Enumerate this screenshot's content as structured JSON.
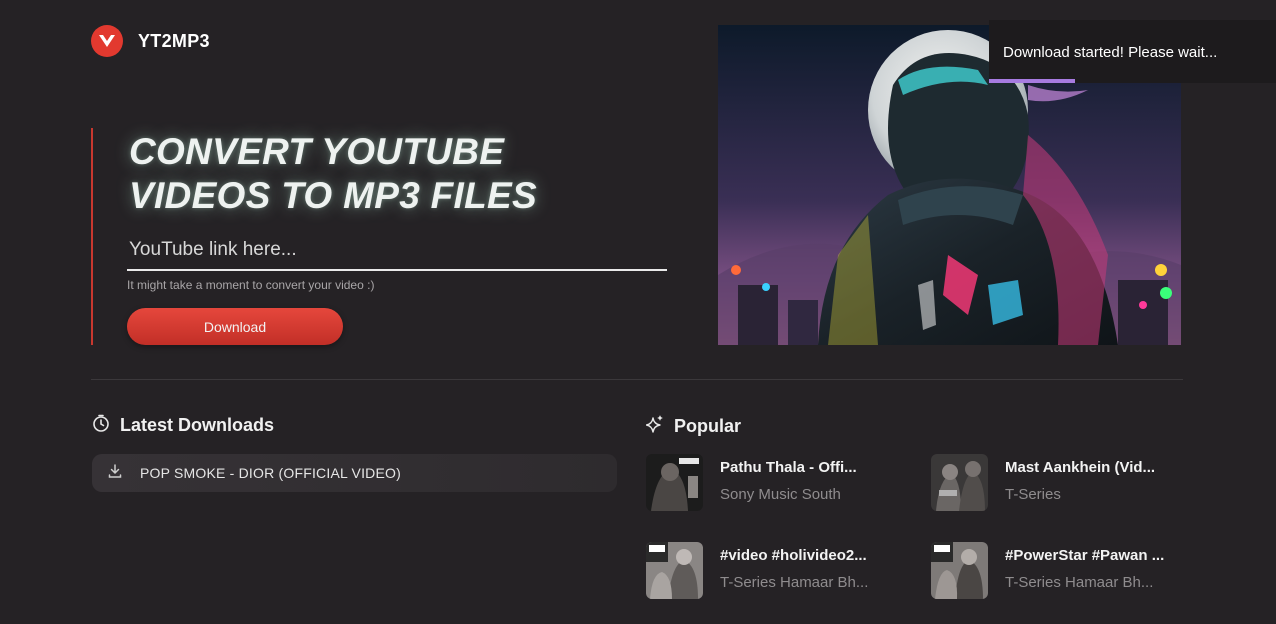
{
  "brand": {
    "name": "YT2MP3",
    "logo_color": "#e2392f",
    "icon": "chevron-v-logo-icon"
  },
  "hero": {
    "title_line1": "CONVERT YOUTUBE",
    "title_line2": "VIDEOS TO MP3 FILES",
    "input_placeholder": "YouTube link here...",
    "input_value": "",
    "hint": "It might take a moment to convert your video :)",
    "download_label": "Download",
    "accent_color": "#c8382f"
  },
  "latest": {
    "title": "Latest Downloads",
    "icon": "clock-icon",
    "items": [
      {
        "label": "POP SMOKE - DIOR (OFFICIAL VIDEO)",
        "icon": "download-icon"
      }
    ]
  },
  "popular": {
    "title": "Popular",
    "icon": "sparkles-icon",
    "items": [
      {
        "title": "Pathu Thala - Offi...",
        "channel": "Sony Music South"
      },
      {
        "title": "Mast Aankhein (Vid...",
        "channel": "T-Series"
      },
      {
        "title": "#video #holivideo2...",
        "channel": "T-Series Hamaar Bh..."
      },
      {
        "title": "#PowerStar #Pawan ...",
        "channel": "T-Series Hamaar Bh..."
      }
    ]
  },
  "toast": {
    "message": "Download started! Please wait...",
    "progress": 0.3,
    "progress_color": "#a77be0"
  }
}
